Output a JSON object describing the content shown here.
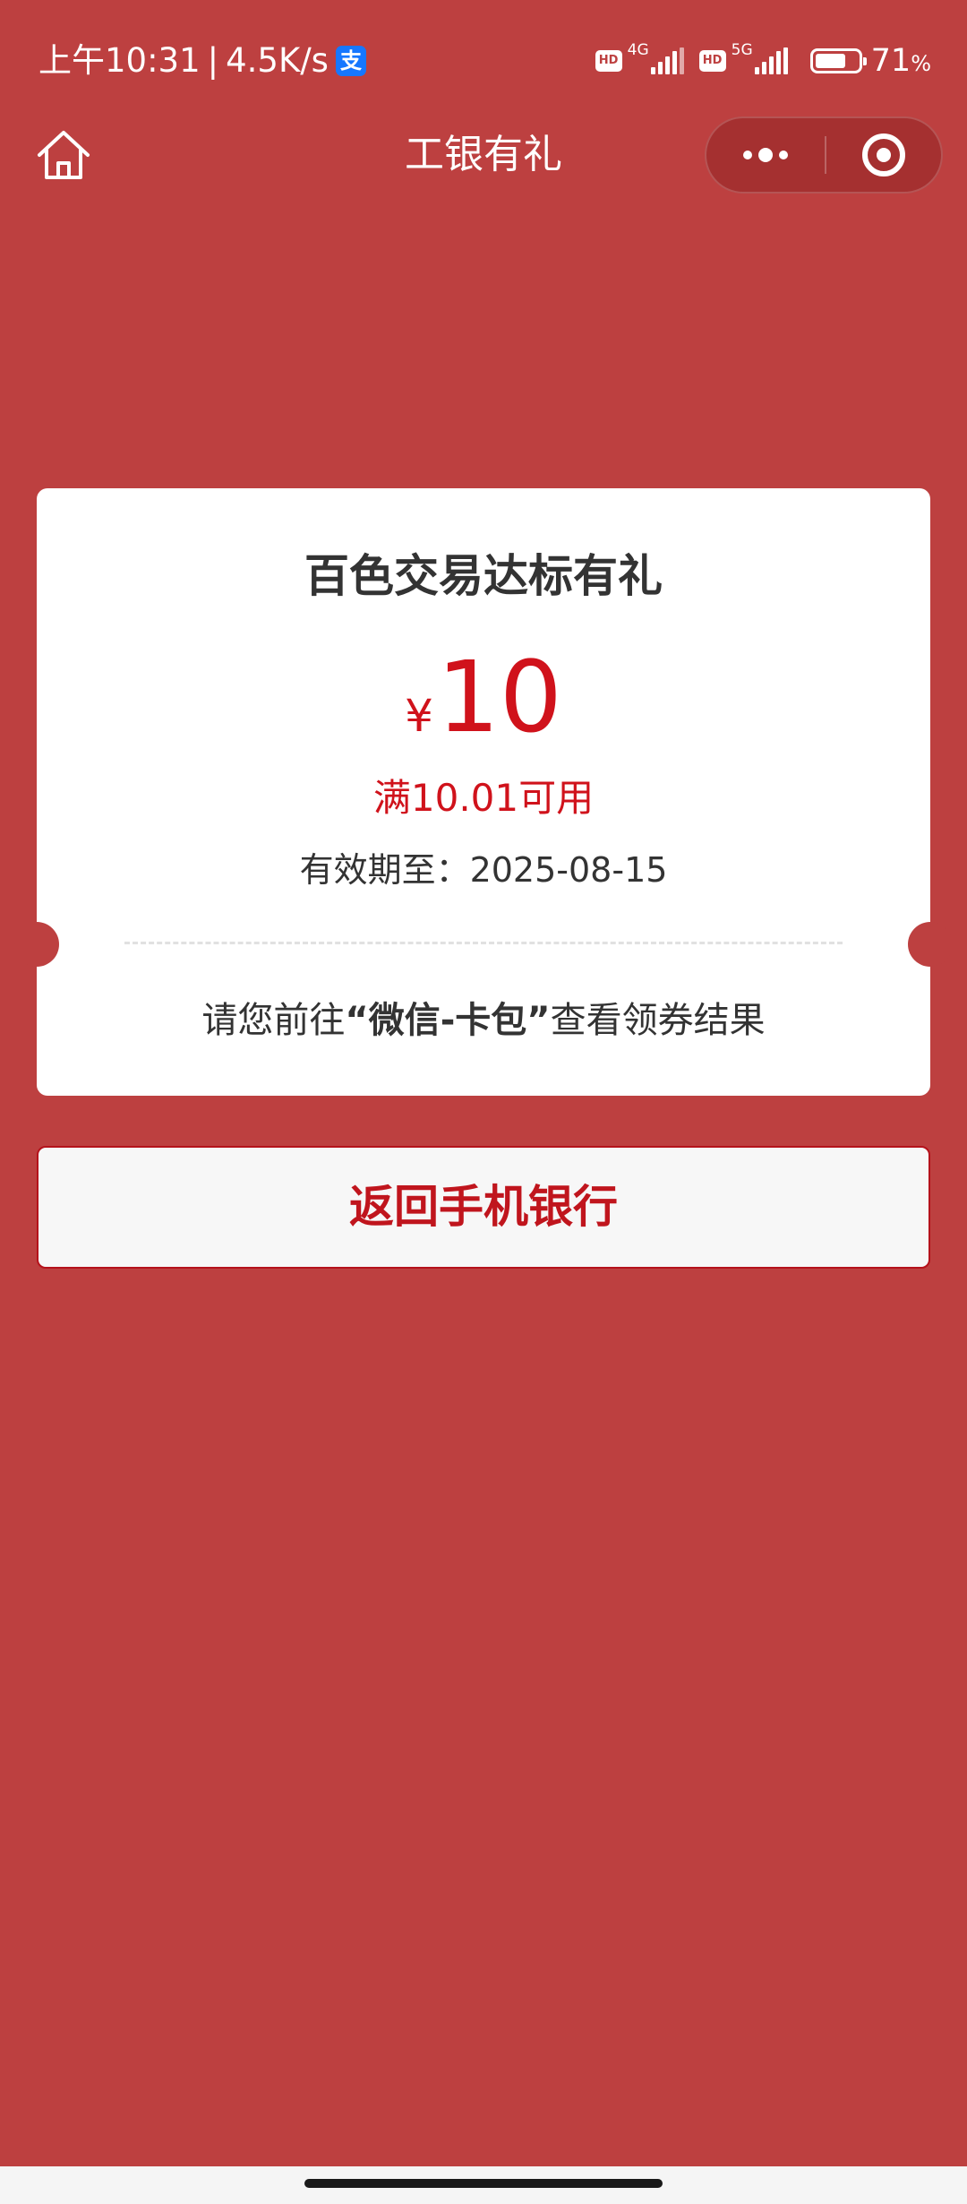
{
  "status_bar": {
    "time": "上午10:31",
    "net_speed": "4.5K/s",
    "alipay_badge": "支",
    "sim1": {
      "hd": "HD",
      "type": "4G"
    },
    "sim2": {
      "hd": "HD",
      "type": "5G"
    },
    "battery_percent": 71,
    "battery_text": "71",
    "battery_unit": "%"
  },
  "nav": {
    "title": "工银有礼",
    "home_icon": "home-icon",
    "more_icon": "more-dots-icon",
    "close_icon": "target-close-icon"
  },
  "coupon": {
    "title": "百色交易达标有礼",
    "currency_symbol": "¥",
    "amount": "10",
    "condition": "满10.01可用",
    "validity": "有效期至：2025-08-15",
    "notice_prefix": "请您前往",
    "notice_highlight": "“微信-卡包”",
    "notice_suffix": "查看领券结果"
  },
  "return_button": {
    "label": "返回手机银行"
  },
  "colors": {
    "background": "#bd4040",
    "accent_red": "#d0121b",
    "card": "#ffffff",
    "button_border": "#b5121b"
  }
}
